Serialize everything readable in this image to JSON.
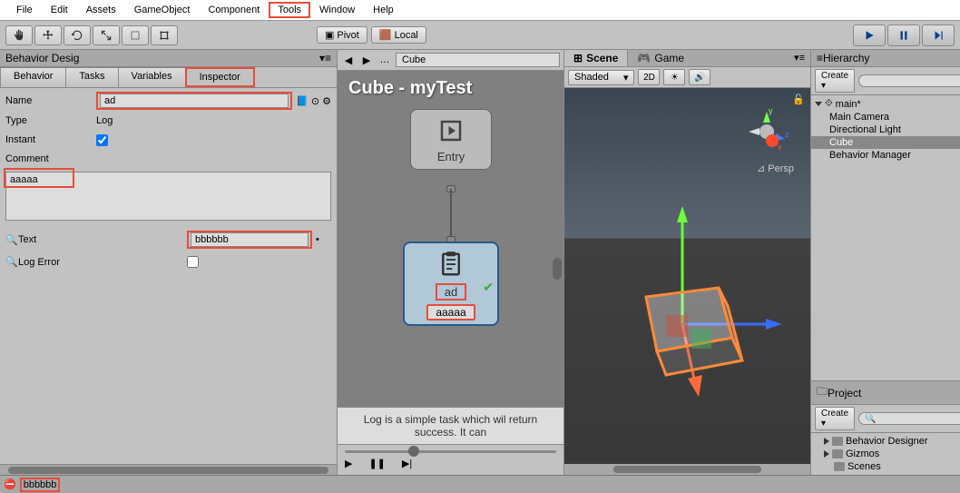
{
  "menu": {
    "items": [
      "File",
      "Edit",
      "Assets",
      "GameObject",
      "Component",
      "Tools",
      "Window",
      "Help"
    ],
    "highlighted": "Tools"
  },
  "toolbar": {
    "pivot": "Pivot",
    "local": "Local"
  },
  "behavior_panel": {
    "title": "Behavior Desig",
    "tabs": [
      "Behavior",
      "Tasks",
      "Variables",
      "Inspector"
    ],
    "active_tab": "Inspector",
    "highlighted_tab": "Inspector",
    "fields": {
      "name_label": "Name",
      "name_value": "ad",
      "type_label": "Type",
      "type_value": "Log",
      "instant_label": "Instant",
      "instant_checked": true,
      "comment_label": "Comment",
      "comment_value": "aaaaa",
      "text_label": "Text",
      "text_value": "bbbbbb",
      "logerror_label": "Log Error",
      "logerror_checked": false
    }
  },
  "graph": {
    "object_name": "Cube",
    "title": "Cube - myTest",
    "entry_label": "Entry",
    "task_label": "ad",
    "task_comment": "aaaaa",
    "description": "Log is a simple task which wil return success. It can"
  },
  "scene": {
    "tabs": [
      {
        "label": "Scene",
        "active": true
      },
      {
        "label": "Game",
        "active": false
      }
    ],
    "mode": "Shaded",
    "btn_2d": "2D",
    "persp": "Persp"
  },
  "hierarchy": {
    "title": "Hierarchy",
    "create": "Create",
    "scene_name": "main*",
    "items": [
      "Main Camera",
      "Directional Light",
      "Cube",
      "Behavior Manager"
    ],
    "selected": "Cube"
  },
  "project": {
    "title": "Project",
    "create": "Create",
    "items": [
      "Behavior Designer",
      "Gizmos",
      "Scenes"
    ]
  },
  "console": {
    "message": "bbbbbb"
  }
}
